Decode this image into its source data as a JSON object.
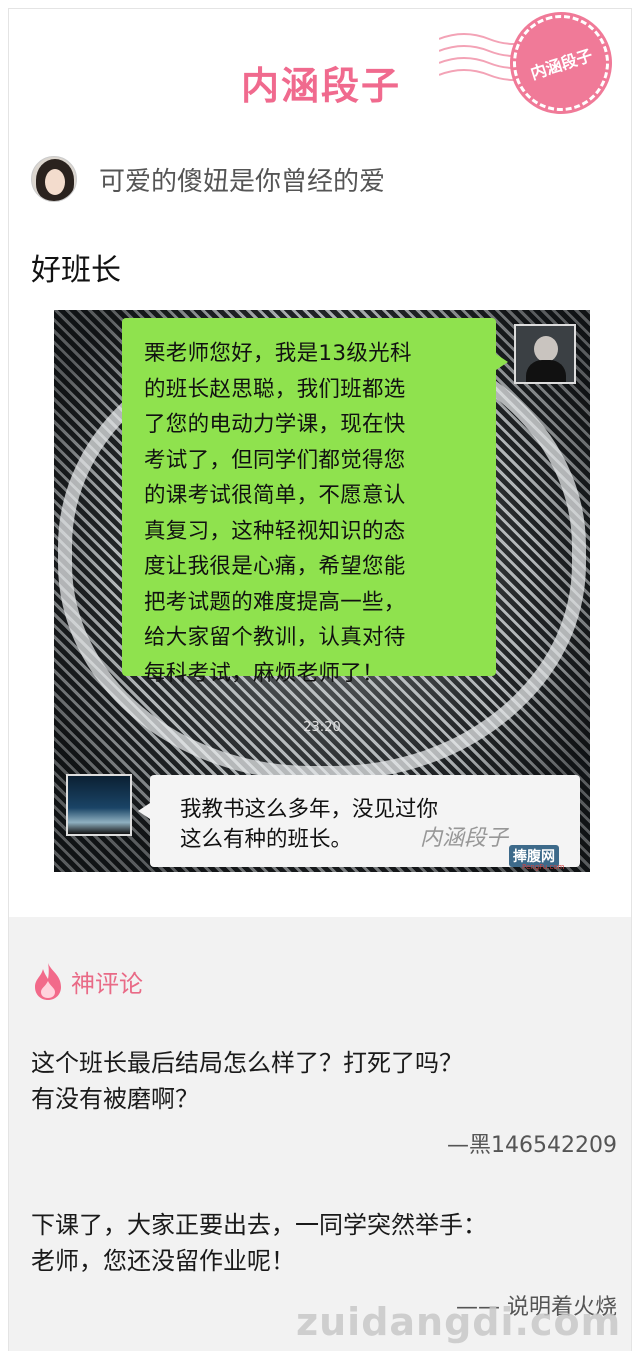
{
  "header": {
    "brand": "内涵段子",
    "stamp_text": "内涵段子"
  },
  "post": {
    "author_name": "可爱的傻妞是你曾经的爱",
    "title": "好班长",
    "image": {
      "message_from_student": "栗老师您好，我是13级光科的班长赵思聪，我们班都选了您的电动力学课，现在快考试了，但同学们都觉得您的课考试很简单，不愿意认真复习，这种轻视知识的态度让我很是心痛，希望您能把考试题的难度提高一些，给大家留个教训，认真对待每科考试，麻烦老师了！",
      "lines": [
        "栗老师您好，我是13级光科",
        "的班长赵思聪，我们班都选",
        "了您的电动力学课，现在快",
        "考试了，但同学们都觉得您",
        "的课考试很简单，不愿意认",
        "真复习，这种轻视知识的态",
        "度让我很是心痛，希望您能",
        "把考试题的难度提高一些，",
        "给大家留个教训，认真对待",
        "每科考试，麻烦老师了！"
      ],
      "timestamp": "23:20",
      "reply_lines": [
        "我教书这么多年，没见过你",
        "这么有种的班长。"
      ],
      "watermark_text": "内涵段子",
      "watermark_logo": "捧腹网",
      "watermark_url": "PengFu.com"
    }
  },
  "comments": {
    "title": "神评论",
    "items": [
      {
        "text_lines": [
          "这个班长最后结局怎么样了？打死了吗？",
          "有没有被磨啊？"
        ],
        "author": "—黑146542209"
      },
      {
        "text_lines": [
          "下课了，大家正要出去，一同学突然举手：",
          "老师，您还没留作业呢！"
        ],
        "author": "—— 说明着火烧"
      }
    ]
  },
  "site_watermark": "zuidangdi.com",
  "colors": {
    "brand_pink": "#f06a8e",
    "wechat_green": "#8fe24e",
    "comments_bg": "#f2f2f2"
  },
  "icons": [
    "stamp-icon",
    "flame-icon"
  ]
}
